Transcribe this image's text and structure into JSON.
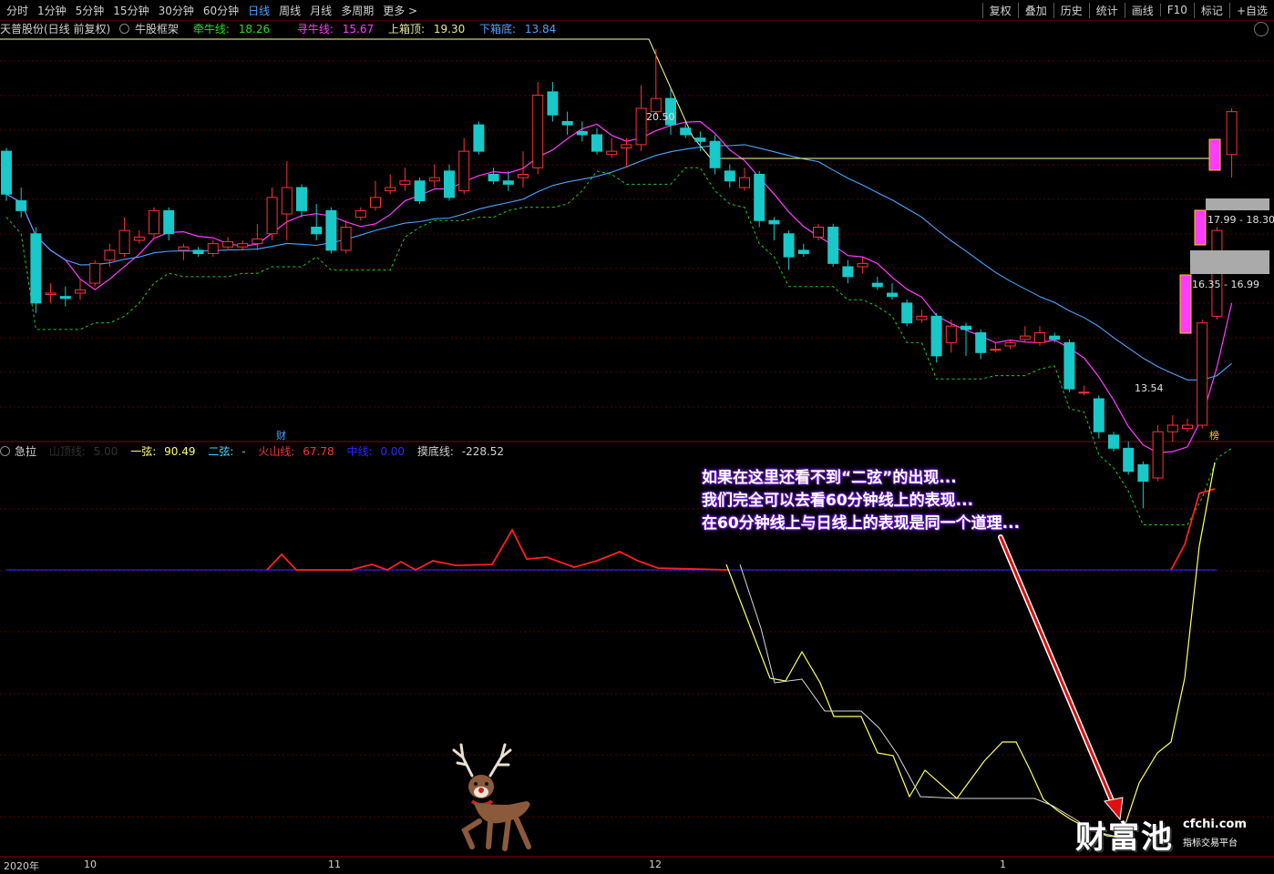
{
  "toolbar": {
    "periods": [
      "分时",
      "1分钟",
      "5分钟",
      "15分钟",
      "30分钟",
      "60分钟",
      "日线",
      "周线",
      "月线",
      "多周期",
      "更多 >"
    ],
    "active": "日线",
    "right": [
      "复权",
      "叠加",
      "历史",
      "统计",
      "画线",
      "F10",
      "标记",
      "+自选"
    ]
  },
  "price_info": {
    "name": "天普股份(日线 前复权)",
    "indicator": "牛股框架",
    "qian_label": "牵牛线:",
    "qian_value": "18.26",
    "xun_label": "寻牛线:",
    "xun_value": "15.67",
    "top_label": "上箱顶:",
    "top_value": "19.30",
    "bottom_label": "下箱底:",
    "bottom_value": "13.84"
  },
  "indicator_info": {
    "name": "急拉",
    "shanding_label": "山顶线:",
    "shanding_value": "5.00",
    "yixian_label": "一弦:",
    "yixian_value": "90.49",
    "erxian_label": "二弦:",
    "erxian_value": "-",
    "huoshan_label": "火山线:",
    "huoshan_value": "67.78",
    "zhong_label": "中线:",
    "zhong_value": "0.00",
    "modi_label": "摸底线:",
    "modi_value": "-228.52"
  },
  "annotations": {
    "high_label": "20.50",
    "low_label": "13.54",
    "zone_upper": "17.99 - 18.30",
    "zone_lower": "16.35 - 16.99",
    "cai_marker": "财",
    "bang_marker": "榜"
  },
  "note_lines": [
    "如果在这里还看不到“二弦”的出现...",
    "我们完全可以去看60分钟线上的表现...",
    "在60分钟线上与日线上的表现是同一个道理..."
  ],
  "date_axis": [
    "2020年",
    "10",
    "11",
    "12",
    "1"
  ],
  "logo": {
    "main": "财富池",
    "site": "cfchi.com",
    "sub": "指标交易平台"
  },
  "colors": {
    "up": "#ff3232",
    "down": "#19c8c8",
    "ma": "#ff3cff",
    "box": "#4aa3ff",
    "trail": "#22cc22",
    "yixian": "#ffff66",
    "huoshan": "#ff2020",
    "zhong": "#2020ff"
  },
  "chart_data": [
    {
      "type": "candlestick",
      "title": "天普股份(日线 前复权)",
      "candles": [
        {
          "o": 18.95,
          "c": 18.3,
          "h": 19.0,
          "l": 18.2
        },
        {
          "o": 18.2,
          "c": 18.05,
          "h": 18.4,
          "l": 17.95
        },
        {
          "o": 17.7,
          "c": 16.65,
          "h": 17.8,
          "l": 16.5
        },
        {
          "o": 16.78,
          "c": 16.8,
          "h": 16.95,
          "l": 16.65
        },
        {
          "o": 16.75,
          "c": 16.72,
          "h": 16.9,
          "l": 16.6
        },
        {
          "o": 16.8,
          "c": 16.85,
          "h": 17.0,
          "l": 16.7
        },
        {
          "o": 16.95,
          "c": 17.25,
          "h": 17.3,
          "l": 16.9
        },
        {
          "o": 17.3,
          "c": 17.45,
          "h": 17.55,
          "l": 17.2
        },
        {
          "o": 17.4,
          "c": 17.75,
          "h": 17.95,
          "l": 17.35
        },
        {
          "o": 17.6,
          "c": 17.65,
          "h": 17.75,
          "l": 17.55
        },
        {
          "o": 17.7,
          "c": 18.05,
          "h": 18.1,
          "l": 17.65
        },
        {
          "o": 18.05,
          "c": 17.7,
          "h": 18.1,
          "l": 17.6
        },
        {
          "o": 17.45,
          "c": 17.5,
          "h": 17.55,
          "l": 17.3
        },
        {
          "o": 17.45,
          "c": 17.4,
          "h": 17.5,
          "l": 17.35
        },
        {
          "o": 17.4,
          "c": 17.55,
          "h": 17.6,
          "l": 17.35
        },
        {
          "o": 17.5,
          "c": 17.58,
          "h": 17.65,
          "l": 17.45
        },
        {
          "o": 17.5,
          "c": 17.55,
          "h": 17.6,
          "l": 17.45
        },
        {
          "o": 17.55,
          "c": 17.62,
          "h": 17.85,
          "l": 17.45
        },
        {
          "o": 17.7,
          "c": 18.25,
          "h": 18.4,
          "l": 17.6
        },
        {
          "o": 18.0,
          "c": 18.4,
          "h": 18.8,
          "l": 17.6
        },
        {
          "o": 18.4,
          "c": 18.05,
          "h": 18.45,
          "l": 17.95
        },
        {
          "o": 17.8,
          "c": 17.7,
          "h": 18.15,
          "l": 17.6
        },
        {
          "o": 18.05,
          "c": 17.45,
          "h": 18.1,
          "l": 17.4
        },
        {
          "o": 17.45,
          "c": 17.8,
          "h": 17.9,
          "l": 17.4
        },
        {
          "o": 17.95,
          "c": 18.05,
          "h": 18.1,
          "l": 17.9
        },
        {
          "o": 18.1,
          "c": 18.25,
          "h": 18.5,
          "l": 18.05
        },
        {
          "o": 18.35,
          "c": 18.4,
          "h": 18.6,
          "l": 18.3
        },
        {
          "o": 18.45,
          "c": 18.5,
          "h": 18.7,
          "l": 18.35
        },
        {
          "o": 18.5,
          "c": 18.2,
          "h": 18.55,
          "l": 18.15
        },
        {
          "o": 18.5,
          "c": 18.55,
          "h": 18.75,
          "l": 18.4
        },
        {
          "o": 18.65,
          "c": 18.25,
          "h": 18.75,
          "l": 18.2
        },
        {
          "o": 18.35,
          "c": 18.95,
          "h": 19.15,
          "l": 18.3
        },
        {
          "o": 19.35,
          "c": 18.95,
          "h": 19.4,
          "l": 18.9
        },
        {
          "o": 18.6,
          "c": 18.5,
          "h": 18.7,
          "l": 18.45
        },
        {
          "o": 18.5,
          "c": 18.45,
          "h": 18.65,
          "l": 18.35
        },
        {
          "o": 18.55,
          "c": 18.6,
          "h": 18.95,
          "l": 18.4
        },
        {
          "o": 18.7,
          "c": 19.8,
          "h": 20.0,
          "l": 18.6
        },
        {
          "o": 19.85,
          "c": 19.5,
          "h": 20.0,
          "l": 19.4
        },
        {
          "o": 19.4,
          "c": 19.35,
          "h": 19.55,
          "l": 19.2
        },
        {
          "o": 19.25,
          "c": 19.2,
          "h": 19.4,
          "l": 19.1
        },
        {
          "o": 19.2,
          "c": 18.95,
          "h": 19.3,
          "l": 18.9
        },
        {
          "o": 18.9,
          "c": 18.95,
          "h": 19.15,
          "l": 18.85
        },
        {
          "o": 19.0,
          "c": 19.05,
          "h": 19.15,
          "l": 18.7
        },
        {
          "o": 19.05,
          "c": 19.6,
          "h": 19.95,
          "l": 18.95
        },
        {
          "o": 19.55,
          "c": 19.75,
          "h": 20.5,
          "l": 19.5
        },
        {
          "o": 19.75,
          "c": 19.35,
          "h": 19.9,
          "l": 19.2
        },
        {
          "o": 19.3,
          "c": 19.2,
          "h": 19.4,
          "l": 19.15
        },
        {
          "o": 19.15,
          "c": 19.1,
          "h": 19.25,
          "l": 18.95
        },
        {
          "o": 19.1,
          "c": 18.7,
          "h": 19.2,
          "l": 18.6
        },
        {
          "o": 18.65,
          "c": 18.5,
          "h": 18.75,
          "l": 18.4
        },
        {
          "o": 18.4,
          "c": 18.55,
          "h": 18.7,
          "l": 18.35
        },
        {
          "o": 18.6,
          "c": 17.9,
          "h": 18.65,
          "l": 17.8
        },
        {
          "o": 17.9,
          "c": 17.85,
          "h": 17.95,
          "l": 17.6
        },
        {
          "o": 17.7,
          "c": 17.35,
          "h": 17.75,
          "l": 17.15
        },
        {
          "o": 17.45,
          "c": 17.4,
          "h": 17.55,
          "l": 17.35
        },
        {
          "o": 17.65,
          "c": 17.8,
          "h": 17.85,
          "l": 17.6
        },
        {
          "o": 17.8,
          "c": 17.25,
          "h": 17.85,
          "l": 17.2
        },
        {
          "o": 17.2,
          "c": 17.05,
          "h": 17.3,
          "l": 16.95
        },
        {
          "o": 17.2,
          "c": 17.25,
          "h": 17.35,
          "l": 17.1
        },
        {
          "o": 16.95,
          "c": 16.9,
          "h": 17.05,
          "l": 16.85
        },
        {
          "o": 16.8,
          "c": 16.75,
          "h": 16.95,
          "l": 16.7
        },
        {
          "o": 16.65,
          "c": 16.35,
          "h": 16.7,
          "l": 16.3
        },
        {
          "o": 16.4,
          "c": 16.45,
          "h": 16.55,
          "l": 16.35
        },
        {
          "o": 16.45,
          "c": 15.85,
          "h": 16.5,
          "l": 15.75
        },
        {
          "o": 16.05,
          "c": 16.3,
          "h": 16.4,
          "l": 15.9
        },
        {
          "o": 16.3,
          "c": 16.25,
          "h": 16.35,
          "l": 15.85
        },
        {
          "o": 16.2,
          "c": 15.9,
          "h": 16.25,
          "l": 15.8
        },
        {
          "o": 15.95,
          "c": 15.95,
          "h": 16.05,
          "l": 15.9
        },
        {
          "o": 16.0,
          "c": 16.05,
          "h": 16.1,
          "l": 15.95
        },
        {
          "o": 16.1,
          "c": 16.15,
          "h": 16.3,
          "l": 16.05
        },
        {
          "o": 16.05,
          "c": 16.2,
          "h": 16.3,
          "l": 16.0
        },
        {
          "o": 16.15,
          "c": 16.1,
          "h": 16.2,
          "l": 16.05
        },
        {
          "o": 16.05,
          "c": 15.35,
          "h": 16.1,
          "l": 15.3
        },
        {
          "o": 15.3,
          "c": 15.3,
          "h": 15.4,
          "l": 15.25
        },
        {
          "o": 15.2,
          "c": 14.7,
          "h": 15.25,
          "l": 14.6
        },
        {
          "o": 14.65,
          "c": 14.45,
          "h": 14.7,
          "l": 14.4
        },
        {
          "o": 14.45,
          "c": 14.1,
          "h": 14.55,
          "l": 14.05
        },
        {
          "o": 14.2,
          "c": 13.95,
          "h": 14.25,
          "l": 13.54
        },
        {
          "o": 14.0,
          "c": 14.7,
          "h": 14.8,
          "l": 13.95
        },
        {
          "o": 14.7,
          "c": 14.8,
          "h": 14.95,
          "l": 14.55
        },
        {
          "o": 14.75,
          "c": 14.8,
          "h": 14.9,
          "l": 14.7
        },
        {
          "o": 14.8,
          "c": 16.35,
          "h": 16.4,
          "l": 14.75
        },
        {
          "o": 16.45,
          "c": 17.75,
          "h": 17.8,
          "l": 16.4
        },
        {
          "o": 18.9,
          "c": 19.55,
          "h": 19.6,
          "l": 18.55
        }
      ]
    },
    {
      "type": "line",
      "title": "急拉",
      "series": [
        {
          "name": "一弦",
          "values": [
            90.49
          ]
        },
        {
          "name": "火山线",
          "values": [
            67.78
          ]
        },
        {
          "name": "中线",
          "values": [
            0.0
          ]
        },
        {
          "name": "摸底线",
          "values": [
            -228.52
          ]
        }
      ]
    }
  ]
}
